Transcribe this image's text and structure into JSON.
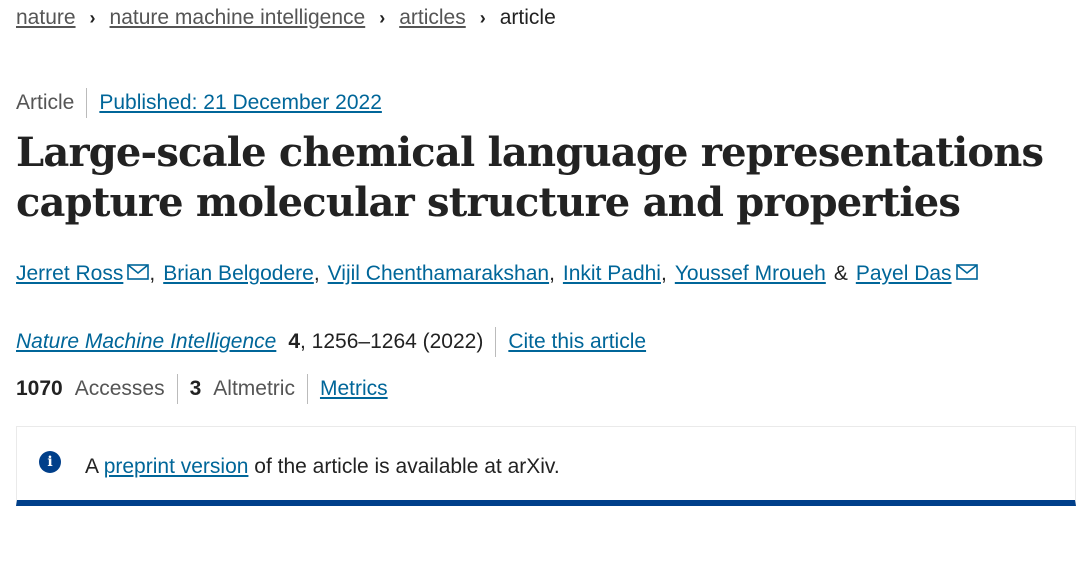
{
  "breadcrumb": {
    "items": [
      "nature",
      "nature machine intelligence",
      "articles"
    ],
    "current": "article"
  },
  "article": {
    "type": "Article",
    "published": "Published: 21 December 2022",
    "title_line1": "Large-scale chemical language representations",
    "title_line2": "capture molecular structure and properties",
    "authors": {
      "a1": "Jerret Ross",
      "a2": "Brian Belgodere",
      "a3": "Vijil Chenthamarakshan",
      "a4": "Inkit Padhi",
      "a5": "Youssef Mroueh",
      "amp": "&",
      "a6": "Payel Das"
    },
    "journal": "Nature Machine Intelligence",
    "volume": "4",
    "pages": ", 1256–1264 (2022)",
    "cite_label": "Cite this article"
  },
  "metrics": {
    "accesses_value": "1070",
    "accesses_label": "Accesses",
    "altmetric_value": "3",
    "altmetric_label": "Altmetric",
    "metrics_link": "Metrics"
  },
  "notice": {
    "prefix": "A",
    "link": "preprint version",
    "suffix": "of the article is available at arXiv.",
    "icon": "info-icon"
  }
}
